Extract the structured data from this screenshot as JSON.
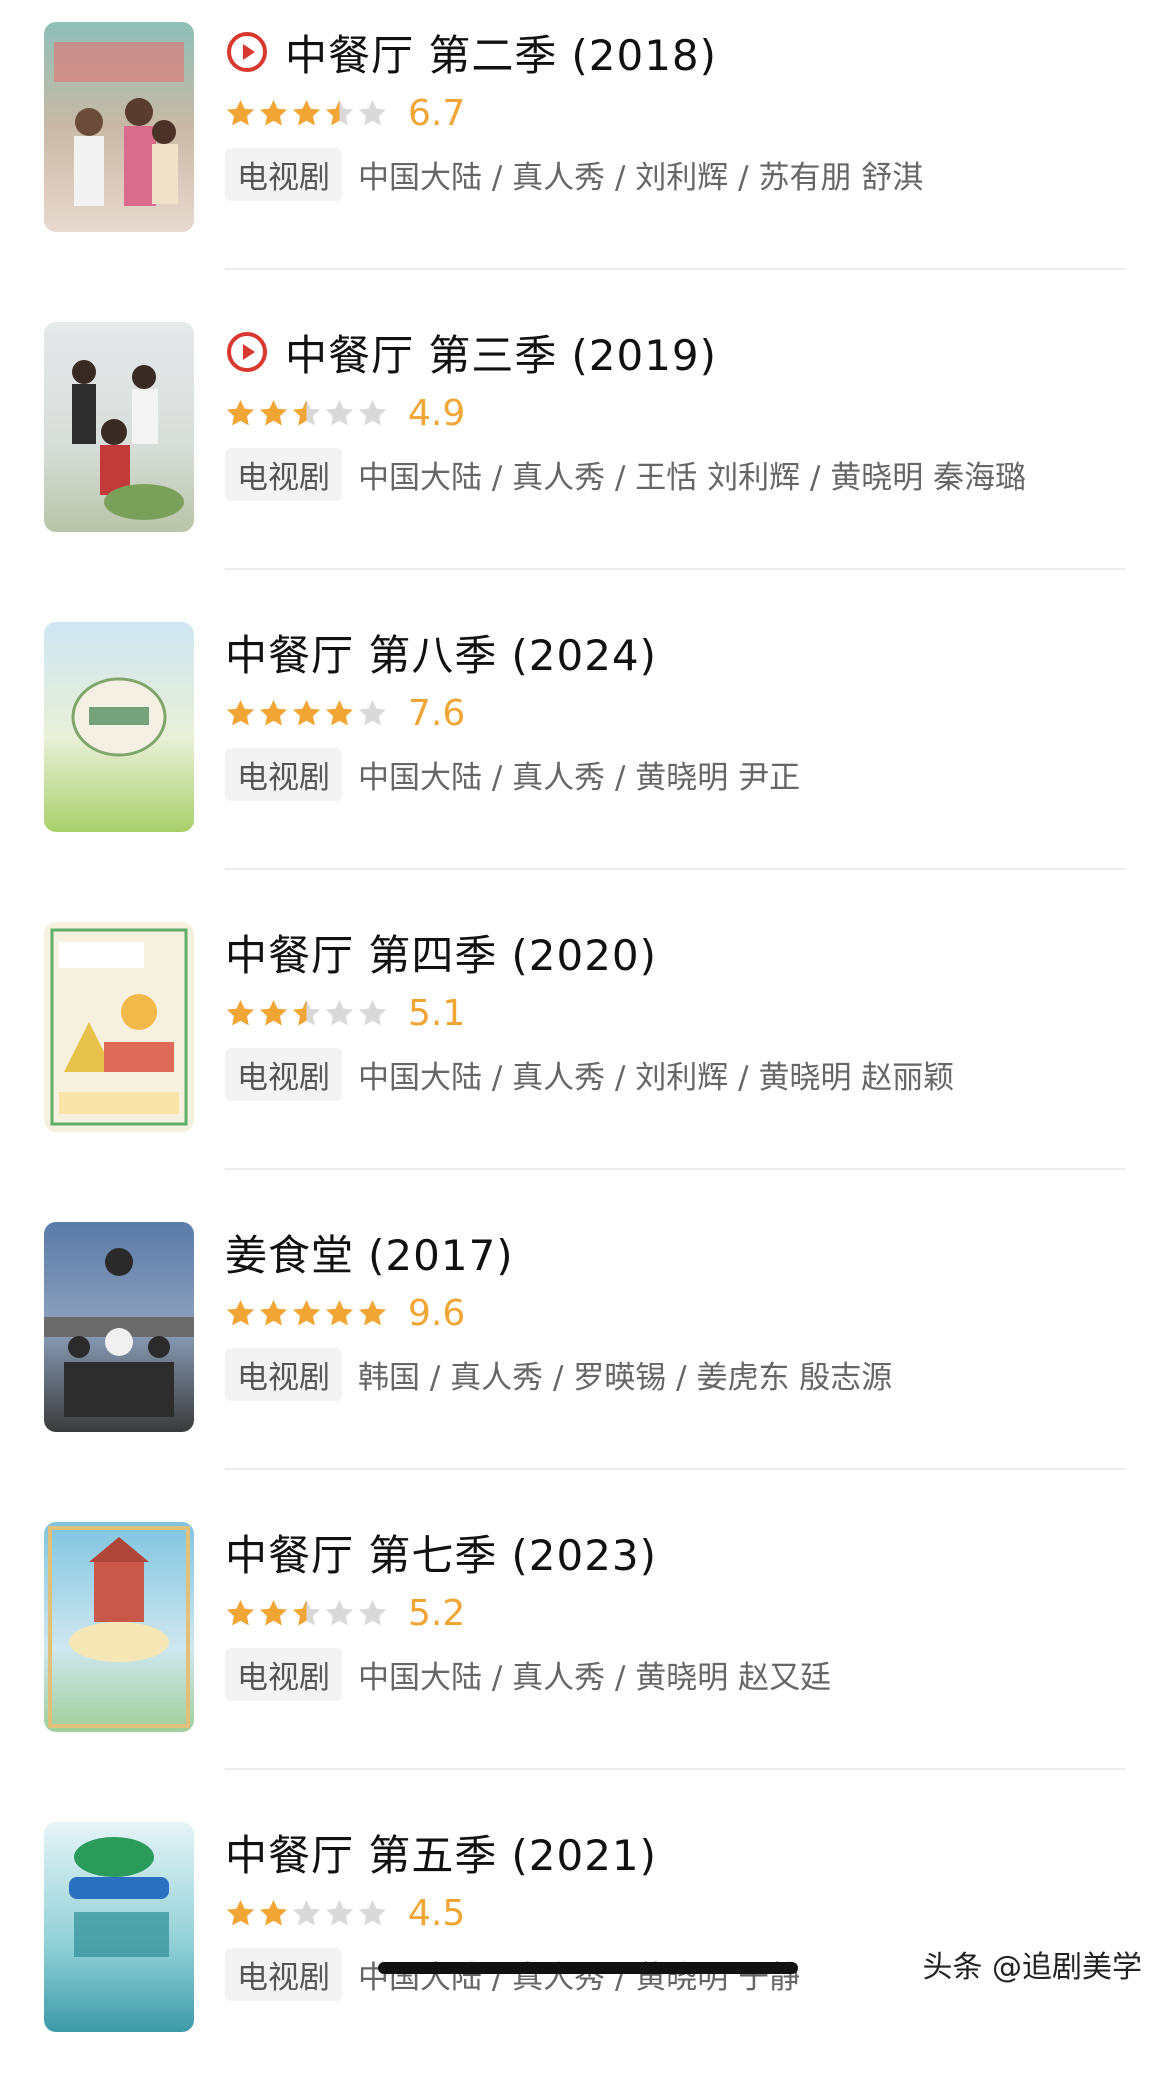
{
  "colors": {
    "star_filled": "#f0a534",
    "star_empty": "#d9d9d9",
    "score": "#f0a534",
    "play_icon": "#d9382e",
    "tag_bg": "#f3f3f3"
  },
  "icons": {
    "play": "play-circle-icon",
    "star": "star-icon"
  },
  "items": [
    {
      "title": "中餐厅 第二季",
      "year": "(2018)",
      "has_play": true,
      "stars": 3.5,
      "score": "6.7",
      "tag": "电视剧",
      "meta": "中国大陆 / 真人秀 / 刘利辉 / 苏有朋 舒淇"
    },
    {
      "title": "中餐厅 第三季",
      "year": "(2019)",
      "has_play": true,
      "stars": 2.5,
      "score": "4.9",
      "tag": "电视剧",
      "meta": "中国大陆 / 真人秀 / 王恬 刘利辉 / 黄晓明 秦海璐"
    },
    {
      "title": "中餐厅 第八季",
      "year": "(2024)",
      "has_play": false,
      "stars": 4,
      "score": "7.6",
      "tag": "电视剧",
      "meta": "中国大陆 / 真人秀 / 黄晓明 尹正"
    },
    {
      "title": "中餐厅 第四季",
      "year": "(2020)",
      "has_play": false,
      "stars": 2.5,
      "score": "5.1",
      "tag": "电视剧",
      "meta": "中国大陆 / 真人秀 / 刘利辉 / 黄晓明 赵丽颖"
    },
    {
      "title": "姜食堂",
      "year": "(2017)",
      "has_play": false,
      "stars": 5,
      "score": "9.6",
      "tag": "电视剧",
      "meta": "韩国 / 真人秀 / 罗暎锡 / 姜虎东 殷志源"
    },
    {
      "title": "中餐厅 第七季",
      "year": "(2023)",
      "has_play": false,
      "stars": 2.5,
      "score": "5.2",
      "tag": "电视剧",
      "meta": "中国大陆 / 真人秀 / 黄晓明 赵又廷"
    },
    {
      "title": "中餐厅 第五季",
      "year": "(2021)",
      "has_play": false,
      "stars": 2,
      "score": "4.5",
      "tag": "电视剧",
      "meta": "中国大陆 / 真人秀 / 黄晓明 于静"
    }
  ],
  "watermark": "头条 @追剧美学"
}
